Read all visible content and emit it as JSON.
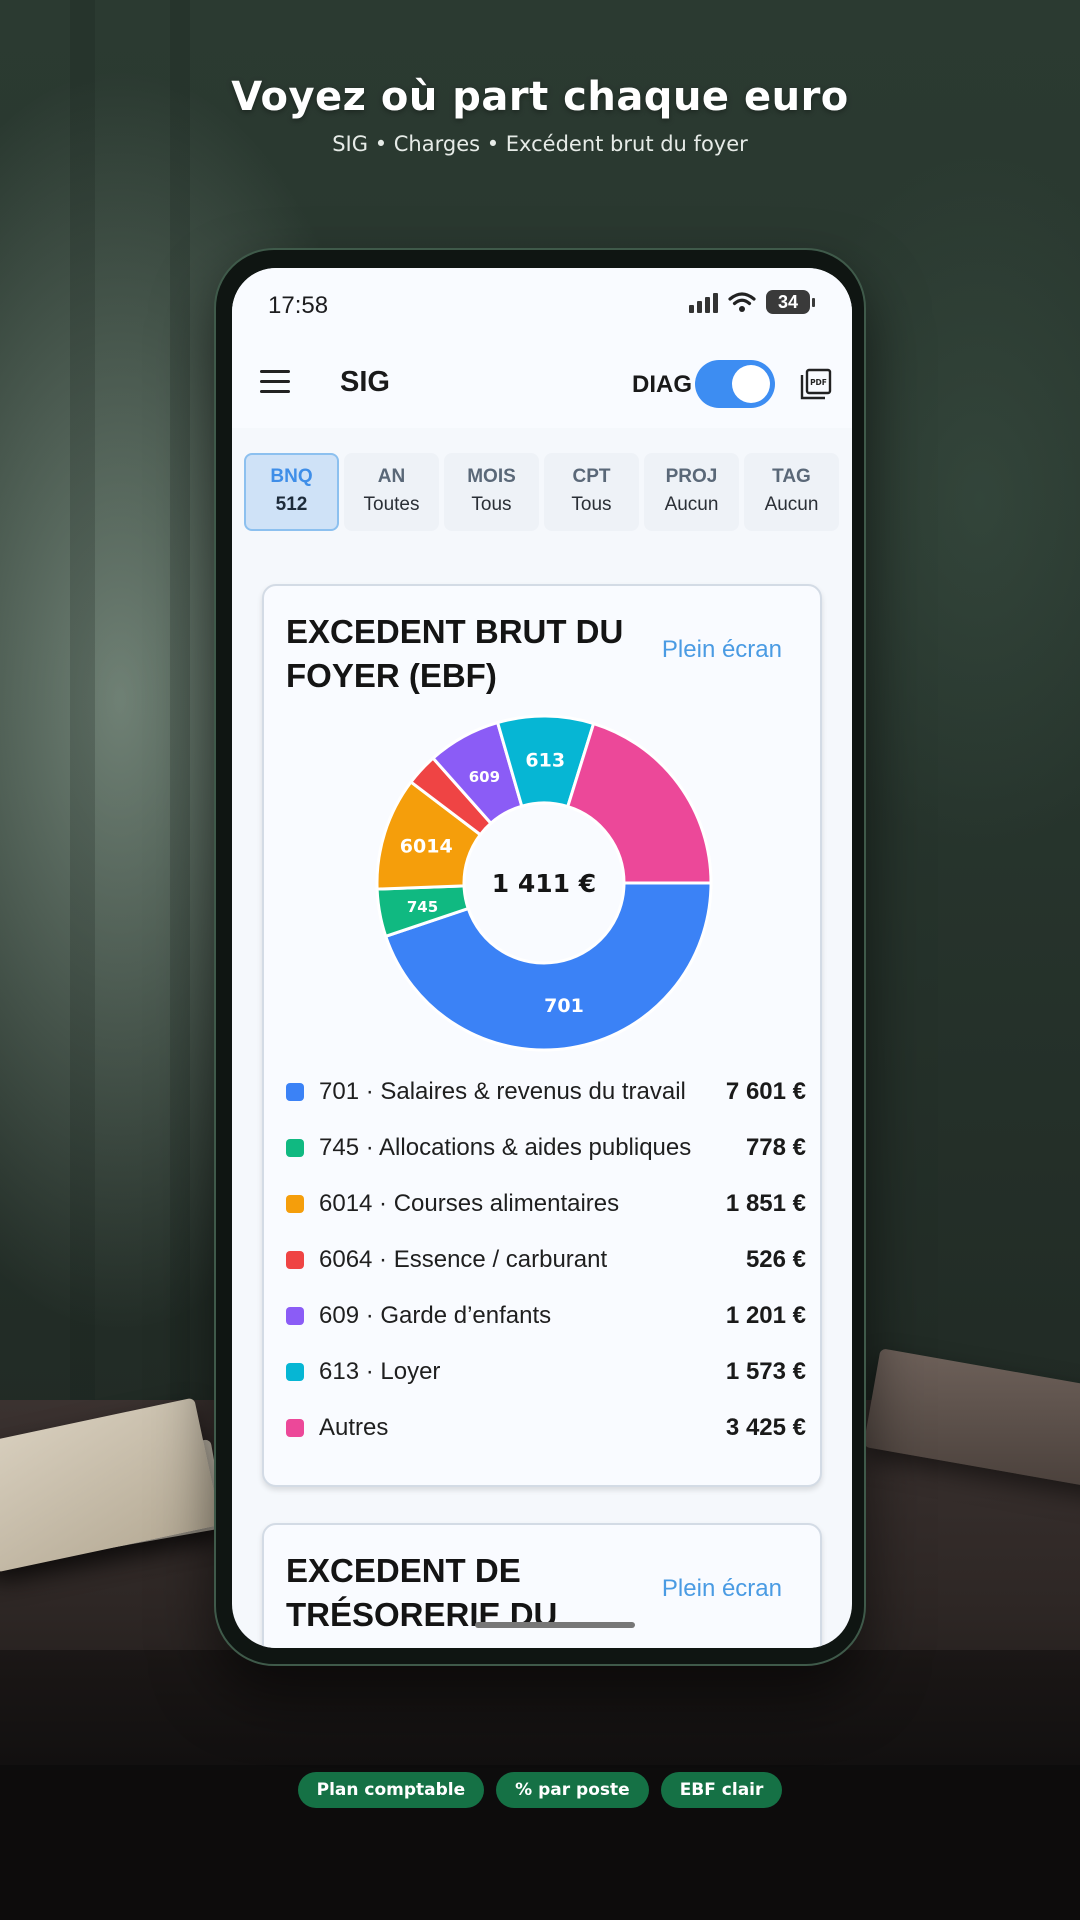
{
  "promo": {
    "headline": "Voyez où part chaque euro",
    "subline": "SIG • Charges • Excédent brut du foyer",
    "badges": [
      "Plan comptable",
      "% par poste",
      "EBF clair"
    ]
  },
  "status_bar": {
    "time": "17:58",
    "battery": "34"
  },
  "app_bar": {
    "title": "SIG",
    "diag_label": "DIAG",
    "diag_on": true
  },
  "filters": [
    {
      "key": "BNQ",
      "value": "512",
      "active": true
    },
    {
      "key": "AN",
      "value": "Toutes",
      "active": false
    },
    {
      "key": "MOIS",
      "value": "Tous",
      "active": false
    },
    {
      "key": "CPT",
      "value": "Tous",
      "active": false
    },
    {
      "key": "PROJ",
      "value": "Aucun",
      "active": false
    },
    {
      "key": "TAG",
      "value": "Aucun",
      "active": false
    }
  ],
  "cards": [
    {
      "title": "EXCEDENT BRUT DU FOYER (EBF)",
      "fullscreen_label": "Plein écran",
      "center_label": "1 411 €"
    },
    {
      "title": "EXCEDENT DE TRÉSORERIE DU",
      "fullscreen_label": "Plein écran"
    }
  ],
  "chart_data": {
    "type": "pie",
    "title": "EXCEDENT BRUT DU FOYER (EBF)",
    "center_label": "1 411 €",
    "slices": [
      {
        "code": "701",
        "label": "701 · Salaires & revenus du travail",
        "amount": "7 601 €",
        "value": 7601,
        "color": "#3b82f6",
        "slice_label": "701"
      },
      {
        "code": "745",
        "label": "745 · Allocations & aides publiques",
        "amount": "778 €",
        "value": 778,
        "color": "#10b981",
        "slice_label": "745"
      },
      {
        "code": "6014",
        "label": "6014 · Courses alimentaires",
        "amount": "1 851 €",
        "value": 1851,
        "color": "#f59e0b",
        "slice_label": "6014"
      },
      {
        "code": "6064",
        "label": "6064 · Essence / carburant",
        "amount": "526 €",
        "value": 526,
        "color": "#ef4444",
        "slice_label": ""
      },
      {
        "code": "609",
        "label": "609 · Garde d’enfants",
        "amount": "1 201 €",
        "value": 1201,
        "color": "#8b5cf6",
        "slice_label": "609"
      },
      {
        "code": "613",
        "label": "613 · Loyer",
        "amount": "1 573 €",
        "value": 1573,
        "color": "#06b6d4",
        "slice_label": "613"
      },
      {
        "code": "autres",
        "label": "Autres",
        "amount": "3 425 €",
        "value": 3425,
        "color": "#ec4899",
        "slice_label": ""
      }
    ]
  }
}
